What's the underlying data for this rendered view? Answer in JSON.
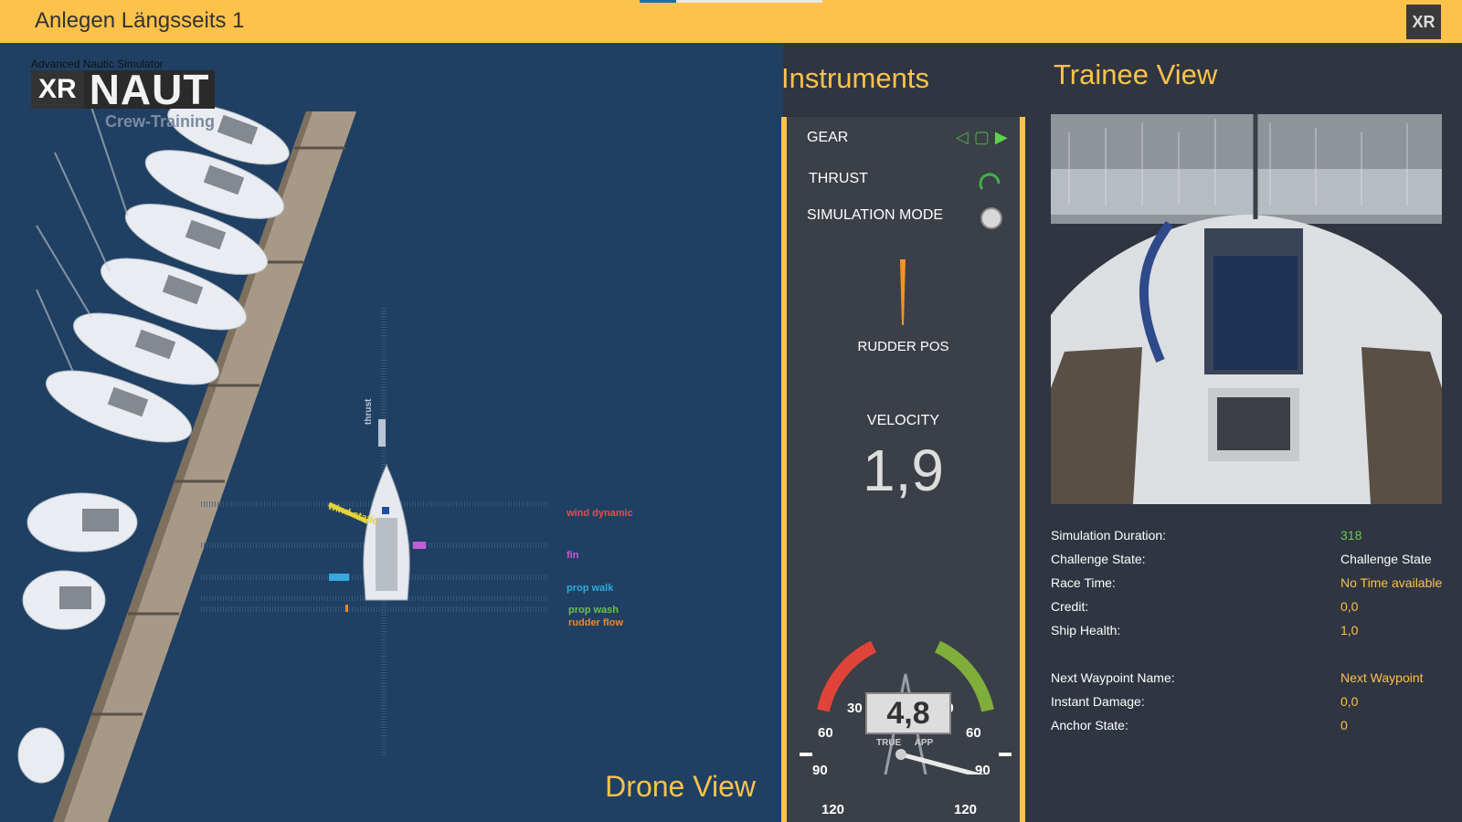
{
  "header": {
    "title": "Anlegen Längsseits 1",
    "progress_fraction": 0.2,
    "xr_icon_label": "XR"
  },
  "drone": {
    "logo_subtitle": "Advanced Nautic Simulator",
    "logo_xr": "XR",
    "logo_naut": "NAUT",
    "logo_crew": "Crew-Training",
    "view_label": "Drone View",
    "forces": {
      "thrust": "thrust",
      "wind_static": "wind static",
      "wind_dynamic": "wind dynamic",
      "fin": "fin",
      "prop_walk": "prop walk",
      "prop_wash": "prop wash",
      "rudder_flow": "rudder flow"
    },
    "colors": {
      "water": "#1f4062",
      "wind_dynamic": "#e0524a",
      "fin": "#c65ad8",
      "prop_walk": "#35a8e0",
      "prop_wash": "#6cc04a",
      "rudder_flow": "#f0842a",
      "wind_static": "#e6d23a"
    }
  },
  "instruments": {
    "title": "Instruments",
    "gear_label": "GEAR",
    "thrust_label": "THRUST",
    "sim_mode_label": "SIMULATION MODE",
    "rudder_label": "RUDDER POS",
    "velocity_label": "VELOCITY",
    "velocity_value": "1,9",
    "wind_value": "4,8",
    "wind_true_label": "TRUE",
    "wind_app_label": "APP",
    "scale": {
      "l30": "30",
      "r30": "30",
      "l60": "60",
      "r60": "60",
      "l90": "90",
      "r90": "90",
      "l120": "120",
      "r120": "120"
    }
  },
  "trainee": {
    "title": "Trainee View",
    "stats": [
      {
        "key": "Simulation Duration:",
        "value": "318",
        "color": "#5fd34a"
      },
      {
        "key": "Challenge State:",
        "value": "Challenge State",
        "color": "#ffffff"
      },
      {
        "key": "Race Time:",
        "value": "No Time available",
        "color": "#fdc24a"
      },
      {
        "key": "Credit:",
        "value": "0,0",
        "color": "#fdc24a"
      },
      {
        "key": "Ship Health:",
        "value": "1,0",
        "color": "#fdc24a"
      },
      {
        "key": "Next Waypoint Name:",
        "value": "Next Waypoint",
        "color": "#fdc24a"
      },
      {
        "key": "Instant Damage:",
        "value": "0,0",
        "color": "#fdc24a"
      },
      {
        "key": "Anchor State:",
        "value": "0",
        "color": "#fdc24a"
      }
    ]
  }
}
